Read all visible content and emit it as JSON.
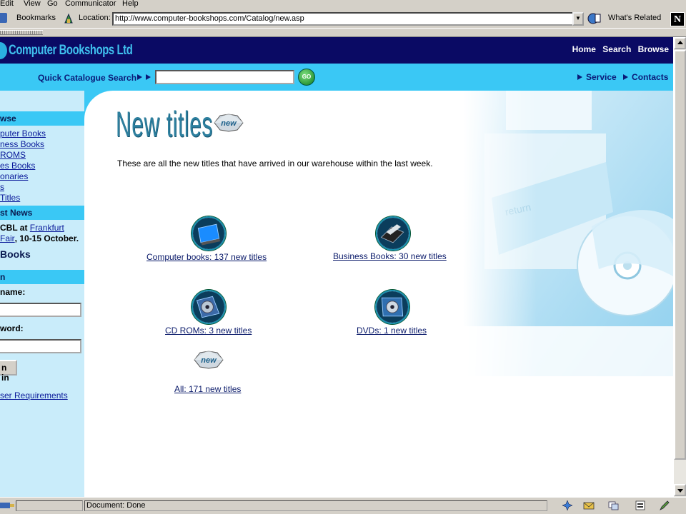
{
  "browser": {
    "menu": [
      "Edit",
      "View",
      "Go",
      "Communicator",
      "Help"
    ],
    "bookmarks_label": "Bookmarks",
    "location_label": "Location:",
    "url": "http://www.computer-bookshops.com/Catalog/new.asp",
    "whats_related_label": "What's Related",
    "status_text": "Document: Done"
  },
  "site": {
    "logo": "Computer Bookshops Ltd",
    "topnav": [
      "Home",
      "Search",
      "Browse"
    ],
    "quick_search_label": "Quick Catalogue Search",
    "quick_search_value": "",
    "go_label": "GO",
    "subnav": [
      "Service",
      "Contacts"
    ]
  },
  "sidebar": {
    "browse_heading": "wse",
    "browse_links": [
      "puter Books",
      "ness Books",
      "ROMS",
      "es Books",
      "onaries",
      "s",
      "Titles"
    ],
    "news_heading": "st News",
    "news_prefix": "CBL at",
    "news_link_1": "Frankfurt",
    "news_link_2": "Fair",
    "news_suffix": ", 10-15 October.",
    "books_heading": "Books",
    "login_heading": "n",
    "username_label": "name:",
    "username_value": "",
    "password_label": "word:",
    "password_value": "",
    "login_button": "n in",
    "requirements_link": "ser Requirements"
  },
  "main": {
    "title": "New titles",
    "badge_text": "new",
    "intro": "These are all the new titles that have arrived in our warehouse within the last week.",
    "categories": [
      {
        "label": "Computer books: 137 new titles",
        "icon": "monitor-icon"
      },
      {
        "label": "Business Books: 30 new titles",
        "icon": "business-icon"
      },
      {
        "label": "CD ROMs: 3 new titles",
        "icon": "cd-rom-icon"
      },
      {
        "label": "DVDs: 1 new titles",
        "icon": "dvd-icon"
      },
      {
        "label": "All: 171 new titles",
        "icon": "new-badge-icon"
      }
    ]
  },
  "colors": {
    "header_dark": "#0a0a64",
    "header_light": "#3ac8f5",
    "sidebar_bg": "#c9ecfa",
    "title": "#2d7f9e",
    "link": "#0a1a6a"
  }
}
